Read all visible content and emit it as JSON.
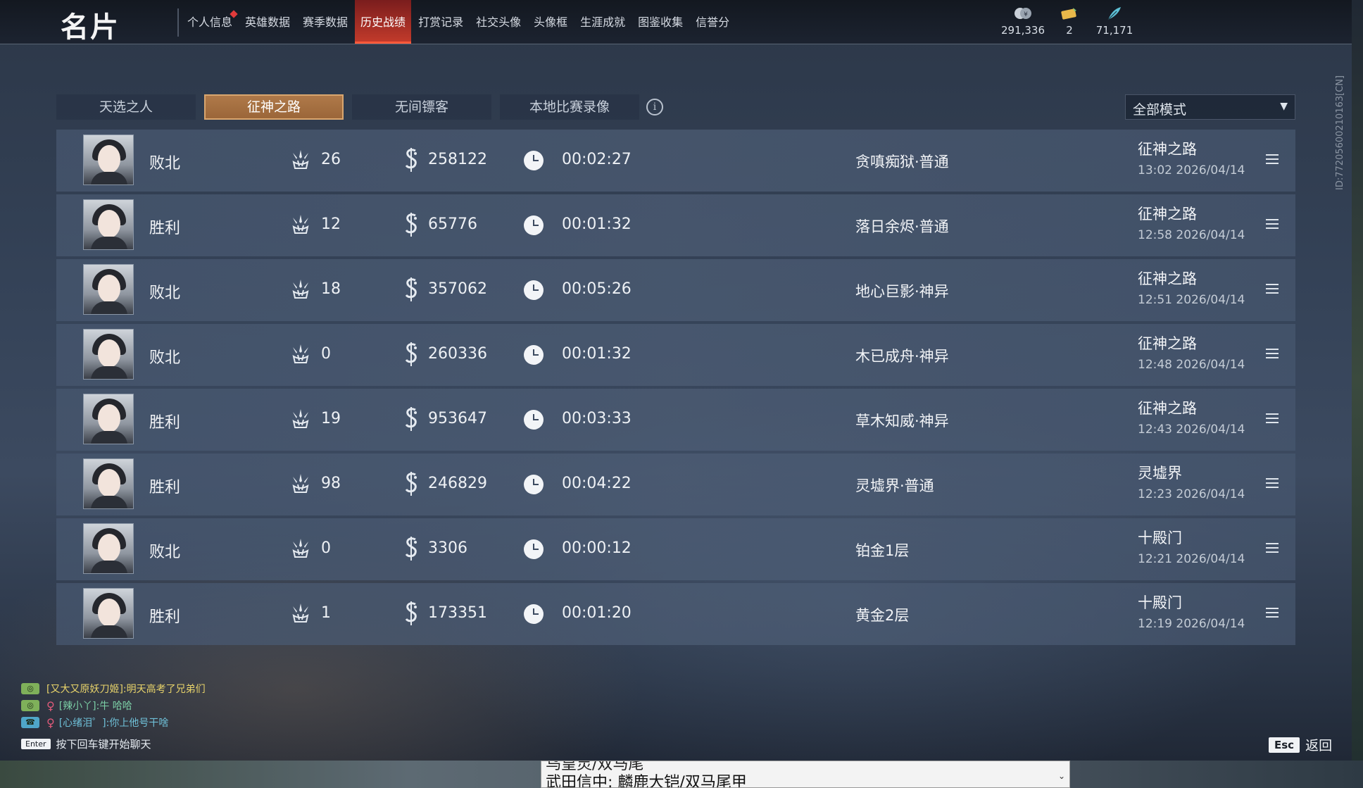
{
  "header": {
    "title": "名片",
    "nav": [
      {
        "label": "个人信息",
        "badge": true,
        "active": false
      },
      {
        "label": "英雄数据",
        "active": false
      },
      {
        "label": "赛季数据",
        "active": false
      },
      {
        "label": "历史战绩",
        "active": true
      },
      {
        "label": "打赏记录",
        "active": false
      },
      {
        "label": "社交头像",
        "active": false
      },
      {
        "label": "头像框",
        "active": false
      },
      {
        "label": "生涯成就",
        "active": false
      },
      {
        "label": "图鉴收集",
        "active": false
      },
      {
        "label": "信誉分",
        "active": false
      }
    ],
    "currencies": [
      {
        "icon": "coin-icon",
        "value": "291,336"
      },
      {
        "icon": "ticket-icon",
        "value": "2"
      },
      {
        "icon": "feather-icon",
        "value": "71,171"
      }
    ]
  },
  "tabs": [
    {
      "label": "天选之人",
      "active": false
    },
    {
      "label": "征神之路",
      "active": true
    },
    {
      "label": "无间镖客",
      "active": false
    },
    {
      "label": "本地比赛录像",
      "active": false
    }
  ],
  "mode_filter": {
    "label": "全部模式"
  },
  "matches": [
    {
      "result": "败北",
      "kills": "26",
      "money": "258122",
      "duration": "00:02:27",
      "map": "贪嗔痴狱·普通",
      "mode": "征神之路",
      "time": "13:02  2026/04/14"
    },
    {
      "result": "胜利",
      "kills": "12",
      "money": "65776",
      "duration": "00:01:32",
      "map": "落日余烬·普通",
      "mode": "征神之路",
      "time": "12:58  2026/04/14"
    },
    {
      "result": "败北",
      "kills": "18",
      "money": "357062",
      "duration": "00:05:26",
      "map": "地心巨影·神异",
      "mode": "征神之路",
      "time": "12:51  2026/04/14"
    },
    {
      "result": "败北",
      "kills": "0",
      "money": "260336",
      "duration": "00:01:32",
      "map": "木已成舟·神异",
      "mode": "征神之路",
      "time": "12:48  2026/04/14"
    },
    {
      "result": "胜利",
      "kills": "19",
      "money": "953647",
      "duration": "00:03:33",
      "map": "草木知威·神异",
      "mode": "征神之路",
      "time": "12:43  2026/04/14"
    },
    {
      "result": "胜利",
      "kills": "98",
      "money": "246829",
      "duration": "00:04:22",
      "map": "灵墟界·普通",
      "mode": "灵墟界",
      "time": "12:23  2026/04/14"
    },
    {
      "result": "败北",
      "kills": "0",
      "money": "3306",
      "duration": "00:00:12",
      "map": "铂金1层",
      "mode": "十殿门",
      "time": "12:21  2026/04/14"
    },
    {
      "result": "胜利",
      "kills": "1",
      "money": "173351",
      "duration": "00:01:20",
      "map": "黄金2层",
      "mode": "十殿门",
      "time": "12:19  2026/04/14"
    }
  ],
  "chat": [
    {
      "text": "[又大又原妖刀姬]:明天高考了兄弟们"
    },
    {
      "text": "[辣小丫]:牛 哈哈"
    },
    {
      "text": "[心绪泪゜]:你上他号干啥"
    }
  ],
  "chat_hint": {
    "key": "Enter",
    "text": "按下回车键开始聊天"
  },
  "back": {
    "key": "Esc",
    "label": "返回"
  },
  "vertical_id": "ID:77205600210163[CN]",
  "bottom_panel": {
    "line1": "乌皇灵/双马尾",
    "line2": "武田信中: 麟鹿大铠/双马尾甲"
  }
}
